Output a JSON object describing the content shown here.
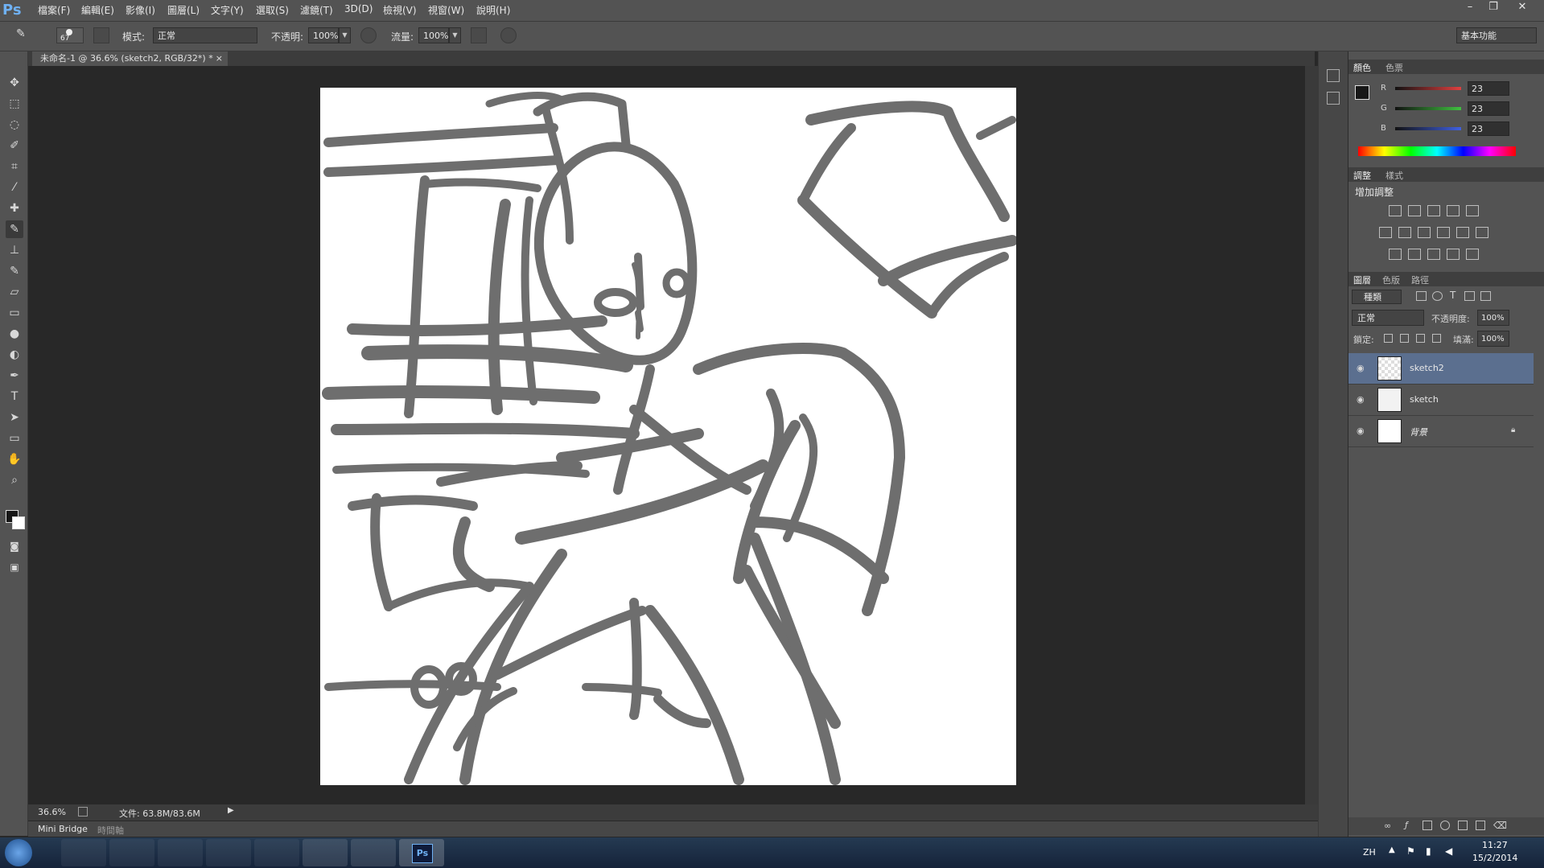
{
  "menubar": {
    "logo": "Ps",
    "items": [
      "檔案(F)",
      "編輯(E)",
      "影像(I)",
      "圖層(L)",
      "文字(Y)",
      "選取(S)",
      "濾鏡(T)",
      "3D(D)",
      "檢視(V)",
      "視窗(W)",
      "說明(H)"
    ],
    "win_min": "–",
    "win_restore": "❐",
    "win_close": "✕"
  },
  "options": {
    "brush_size": "67",
    "mode_label": "模式:",
    "mode_value": "正常",
    "opacity_label": "不透明:",
    "opacity_value": "100%",
    "flow_label": "流量:",
    "flow_value": "100%",
    "workspace": "基本功能"
  },
  "document": {
    "tab_title": "未命名-1 @ 36.6% (sketch2, RGB/32*) *",
    "tab_close": "×"
  },
  "status": {
    "zoom": "36.6%",
    "file_info": "文件: 63.8M/83.6M"
  },
  "bottom_tabs": [
    "Mini Bridge",
    "時間軸"
  ],
  "color_panel": {
    "tabs": [
      "顏色",
      "色票"
    ],
    "channels": [
      {
        "label": "R",
        "value": "23",
        "color": "#e04040"
      },
      {
        "label": "G",
        "value": "23",
        "color": "#40c040"
      },
      {
        "label": "B",
        "value": "23",
        "color": "#4060e0"
      }
    ]
  },
  "adjust_panel": {
    "tabs": [
      "調整",
      "樣式"
    ],
    "title": "增加調整"
  },
  "layers_panel": {
    "tabs": [
      "圖層",
      "色版",
      "路徑"
    ],
    "filter_label": "種類",
    "blend_mode": "正常",
    "opacity_label": "不透明度:",
    "opacity_value": "100%",
    "lock_label": "鎖定:",
    "fill_label": "填滿:",
    "fill_value": "100%",
    "layers": [
      {
        "name": "sketch2",
        "selected": true
      },
      {
        "name": "sketch",
        "selected": false
      },
      {
        "name": "背景",
        "selected": false,
        "locked": true
      }
    ]
  },
  "taskbar": {
    "lang": "ZH",
    "time": "11:27",
    "date": "15/2/2014"
  }
}
